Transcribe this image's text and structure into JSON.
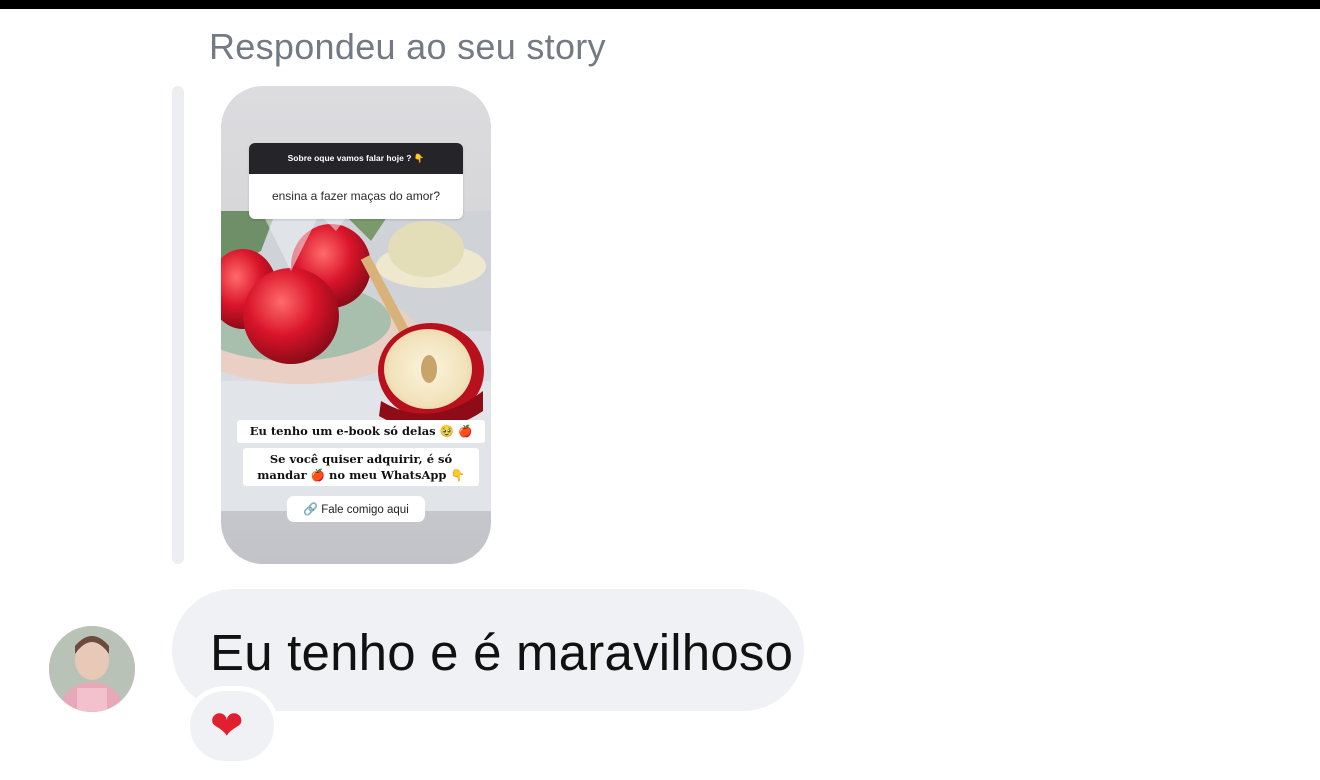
{
  "reply_label": "Respondeu ao seu story",
  "story": {
    "question": "Sobre oque vamos falar hoje ? 👇",
    "answer": "ensina a fazer maças do amor?",
    "caption_line1": "Eu tenho um e-book só delas 🥹 🍎",
    "caption_line2a": "Se você quiser adquirir, é só",
    "caption_line2b": "mandar 🍎 no meu WhatsApp 👇",
    "link_label": "Fale comigo aqui"
  },
  "message": {
    "text": "Eu tenho e é maravilhoso",
    "reaction": "❤"
  },
  "colors": {
    "bubble_bg": "#f0f1f4",
    "label_gray": "#737a83",
    "heart_red": "#e0202f",
    "link_blue": "#3a7bd5"
  }
}
